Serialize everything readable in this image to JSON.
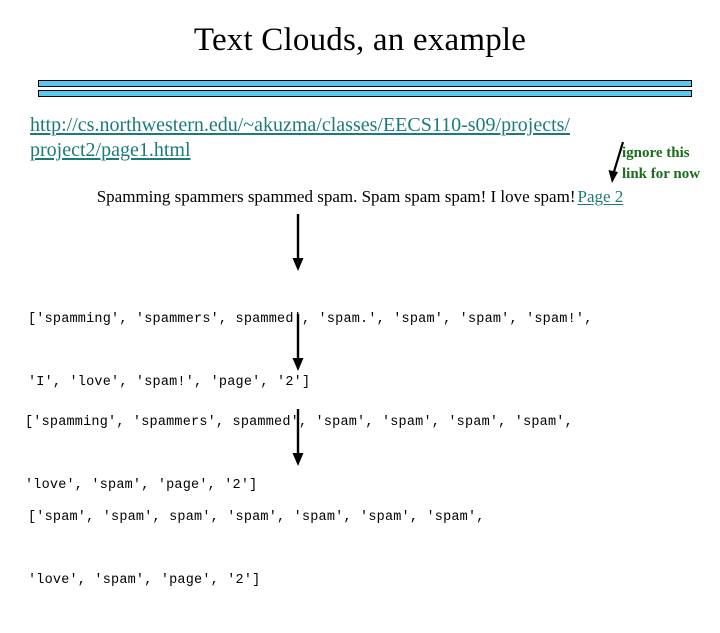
{
  "slide": {
    "title": "Text Clouds, an example",
    "accent_color": "#5BC8F0",
    "link_color": "#1B7B7B",
    "annotation_color": "#1D6B1D"
  },
  "url": {
    "line1": "http://cs.northwestern.edu/~akuzma/classes/EECS110-s09/projects/",
    "line2": "project2/page1.html"
  },
  "annotation": {
    "line1": "ignore this",
    "line2": "link for now",
    "arrow_icon": "down-left-arrow-icon"
  },
  "sentence": {
    "text": "Spamming spammers spammed spam. Spam spam spam! I love spam!",
    "page_link": "Page 2"
  },
  "arrows": {
    "arrow1_icon": "down-arrow-icon",
    "arrow2_icon": "down-arrow-icon",
    "arrow3_icon": "down-arrow-icon"
  },
  "token_lists": [
    {
      "id": "raw-tokens",
      "line1": "['spamming', 'spammers', spammed', 'spam.', 'spam', 'spam', 'spam!',",
      "line2": "'I', 'love', 'spam!', 'page', '2']"
    },
    {
      "id": "punctuation-stripped-tokens",
      "line1": "['spamming', 'spammers', spammed', 'spam', 'spam', 'spam', 'spam',",
      "line2": "'love', 'spam', 'page', '2']"
    },
    {
      "id": "stemmed-tokens",
      "line1": "['spam', 'spam', spam', 'spam', 'spam', 'spam', 'spam',",
      "line2": "'love', 'spam', 'page', '2']"
    }
  ]
}
